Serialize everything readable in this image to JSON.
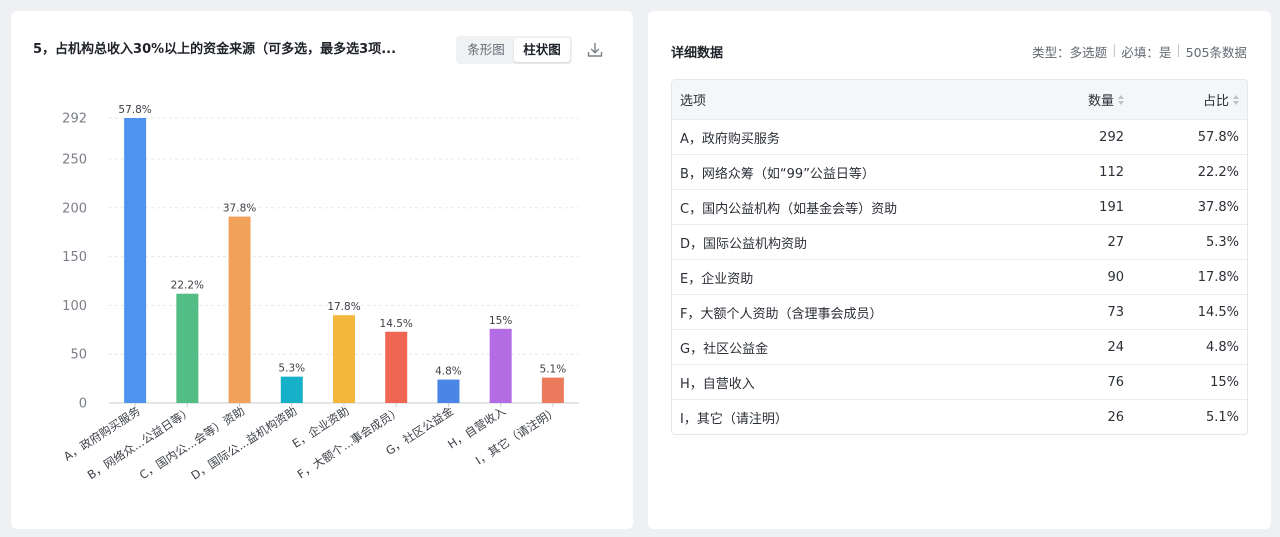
{
  "chart_title": "5，占机构总收入30%以上的资金来源（可多选，最多选3项...",
  "toggle": {
    "bar_label": "条形图",
    "column_label": "柱状图"
  },
  "detail": {
    "title": "详细数据",
    "type_label": "类型：多选题",
    "required_label": "必填：是",
    "count_label": "505条数据",
    "headers": {
      "option": "选项",
      "count": "数量",
      "ratio": "占比"
    },
    "rows": [
      {
        "option": "A，政府购买服务",
        "count": "292",
        "ratio": "57.8%"
      },
      {
        "option": "B，网络众筹（如“99”公益日等）",
        "count": "112",
        "ratio": "22.2%"
      },
      {
        "option": "C，国内公益机构（如基金会等）资助",
        "count": "191",
        "ratio": "37.8%"
      },
      {
        "option": "D，国际公益机构资助",
        "count": "27",
        "ratio": "5.3%"
      },
      {
        "option": "E，企业资助",
        "count": "90",
        "ratio": "17.8%"
      },
      {
        "option": "F，大额个人资助（含理事会成员）",
        "count": "73",
        "ratio": "14.5%"
      },
      {
        "option": "G，社区公益金",
        "count": "24",
        "ratio": "4.8%"
      },
      {
        "option": "H，自营收入",
        "count": "76",
        "ratio": "15%"
      },
      {
        "option": "I，其它（请注明）",
        "count": "26",
        "ratio": "5.1%"
      }
    ]
  },
  "chart_data": {
    "type": "bar",
    "categories": [
      "A，政府购买服务",
      "B，网络众...公益日等）",
      "C，国内公...会等）资助",
      "D，国际公...益机构资助",
      "E，企业资助",
      "F，大额个...事会成员）",
      "G，社区公益金",
      "H，自营收入",
      "I，其它（请注明）"
    ],
    "values": [
      292,
      112,
      191,
      27,
      90,
      73,
      24,
      76,
      26
    ],
    "data_labels": [
      "57.8%",
      "22.2%",
      "37.8%",
      "5.3%",
      "17.8%",
      "14.5%",
      "4.8%",
      "15%",
      "5.1%"
    ],
    "colors": [
      "#4e94ee",
      "#53bd86",
      "#f2a15a",
      "#16b1c8",
      "#f5b63d",
      "#ef6753",
      "#4b86e7",
      "#b46ce4",
      "#eb7b5c"
    ],
    "yticks": [
      0,
      50,
      100,
      150,
      200,
      250,
      292
    ],
    "ylim": [
      0,
      292
    ],
    "grid": true,
    "gridline_color": "#e6e8eb",
    "axis_color": "#c9ccd1",
    "tick_label_color": "#7a7f87"
  }
}
